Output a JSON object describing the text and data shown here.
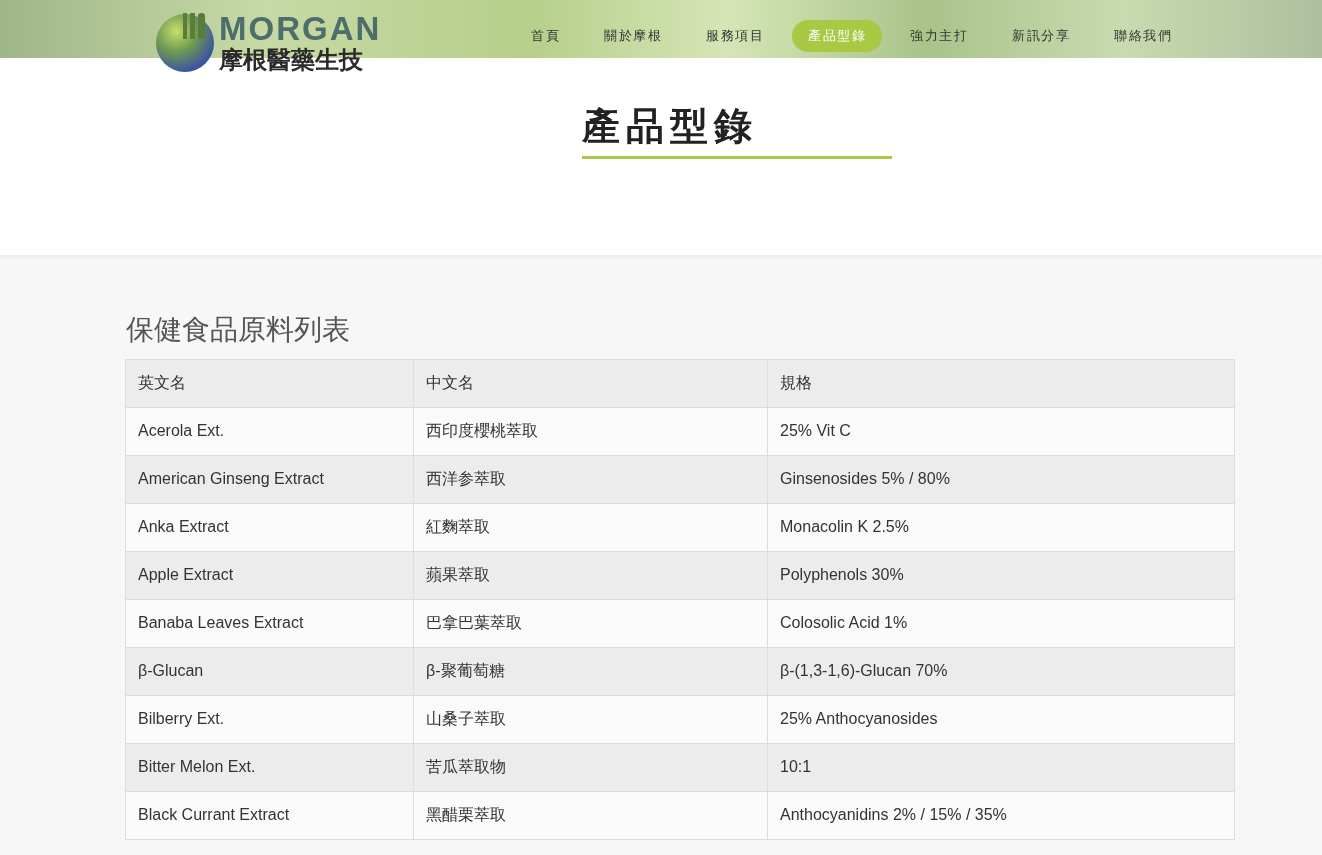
{
  "logo": {
    "name": "MORGAN",
    "subtitle": "摩根醫藥生技"
  },
  "nav": [
    {
      "label": "首頁",
      "selected": false
    },
    {
      "label": "關於摩根",
      "selected": false
    },
    {
      "label": "服務項目",
      "selected": false
    },
    {
      "label": "產品型錄",
      "selected": true
    },
    {
      "label": "強力主打",
      "selected": false
    },
    {
      "label": "新訊分享",
      "selected": false
    },
    {
      "label": "聯絡我們",
      "selected": false
    }
  ],
  "page_title": "產品型錄",
  "section_title": "保健食品原料列表",
  "table": {
    "columns": [
      "英文名",
      "中文名",
      "規格"
    ],
    "rows": [
      [
        "Acerola Ext.",
        "西印度櫻桃萃取",
        "25% Vit C"
      ],
      [
        "American Ginseng Extract",
        "西洋参萃取",
        "Ginsenosides 5% / 80%"
      ],
      [
        "Anka Extract",
        "紅麴萃取",
        "Monacolin K 2.5%"
      ],
      [
        "Apple Extract",
        "蘋果萃取",
        "Polyphenols 30%"
      ],
      [
        "Banaba Leaves Extract",
        "巴拿巴葉萃取",
        "Colosolic Acid 1%"
      ],
      [
        "β-Glucan",
        "β-聚葡萄糖",
        "β-(1,3-1,6)-Glucan 70%"
      ],
      [
        "Bilberry Ext.",
        "山桑子萃取",
        "25% Anthocyanosides"
      ],
      [
        "Bitter Melon Ext.",
        "苦瓜萃取物",
        "10:1"
      ],
      [
        "Black Currant Extract",
        "黑醋栗萃取",
        "Anthocyanidins 2% / 15% / 35%"
      ]
    ]
  }
}
